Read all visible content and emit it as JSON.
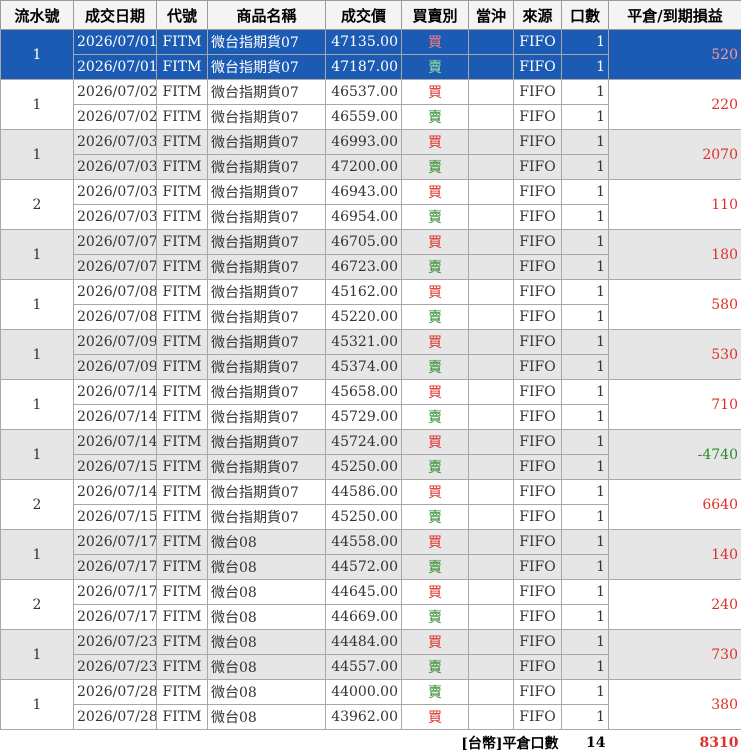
{
  "headers": [
    "流水號",
    "成交日期",
    "代號",
    "商品名稱",
    "成交價",
    "買賣別",
    "當沖",
    "來源",
    "口數",
    "平倉/到期損益"
  ],
  "groups": [
    {
      "seq": "1",
      "pl": "520",
      "pl_sign": "pos",
      "rows": [
        {
          "date": "2026/07/01",
          "code": "FITM",
          "name": "微台指期貨07",
          "price": "47135.00",
          "side": "買",
          "side_type": "buy",
          "daytrade": "",
          "source": "FIFO",
          "qty": "1"
        },
        {
          "date": "2026/07/01",
          "code": "FITM",
          "name": "微台指期貨07",
          "price": "47187.00",
          "side": "賣",
          "side_type": "sell",
          "daytrade": "",
          "source": "FIFO",
          "qty": "1"
        }
      ]
    },
    {
      "seq": "1",
      "pl": "220",
      "pl_sign": "pos",
      "rows": [
        {
          "date": "2026/07/02",
          "code": "FITM",
          "name": "微台指期貨07",
          "price": "46537.00",
          "side": "買",
          "side_type": "buy",
          "daytrade": "",
          "source": "FIFO",
          "qty": "1"
        },
        {
          "date": "2026/07/02",
          "code": "FITM",
          "name": "微台指期貨07",
          "price": "46559.00",
          "side": "賣",
          "side_type": "sell",
          "daytrade": "",
          "source": "FIFO",
          "qty": "1"
        }
      ]
    },
    {
      "seq": "1",
      "pl": "2070",
      "pl_sign": "pos",
      "rows": [
        {
          "date": "2026/07/03",
          "code": "FITM",
          "name": "微台指期貨07",
          "price": "46993.00",
          "side": "買",
          "side_type": "buy",
          "daytrade": "",
          "source": "FIFO",
          "qty": "1"
        },
        {
          "date": "2026/07/03",
          "code": "FITM",
          "name": "微台指期貨07",
          "price": "47200.00",
          "side": "賣",
          "side_type": "sell",
          "daytrade": "",
          "source": "FIFO",
          "qty": "1"
        }
      ]
    },
    {
      "seq": "2",
      "pl": "110",
      "pl_sign": "pos",
      "rows": [
        {
          "date": "2026/07/03",
          "code": "FITM",
          "name": "微台指期貨07",
          "price": "46943.00",
          "side": "買",
          "side_type": "buy",
          "daytrade": "",
          "source": "FIFO",
          "qty": "1"
        },
        {
          "date": "2026/07/03",
          "code": "FITM",
          "name": "微台指期貨07",
          "price": "46954.00",
          "side": "賣",
          "side_type": "sell",
          "daytrade": "",
          "source": "FIFO",
          "qty": "1"
        }
      ]
    },
    {
      "seq": "1",
      "pl": "180",
      "pl_sign": "pos",
      "rows": [
        {
          "date": "2026/07/07",
          "code": "FITM",
          "name": "微台指期貨07",
          "price": "46705.00",
          "side": "買",
          "side_type": "buy",
          "daytrade": "",
          "source": "FIFO",
          "qty": "1"
        },
        {
          "date": "2026/07/07",
          "code": "FITM",
          "name": "微台指期貨07",
          "price": "46723.00",
          "side": "賣",
          "side_type": "sell",
          "daytrade": "",
          "source": "FIFO",
          "qty": "1"
        }
      ]
    },
    {
      "seq": "1",
      "pl": "580",
      "pl_sign": "pos",
      "rows": [
        {
          "date": "2026/07/08",
          "code": "FITM",
          "name": "微台指期貨07",
          "price": "45162.00",
          "side": "買",
          "side_type": "buy",
          "daytrade": "",
          "source": "FIFO",
          "qty": "1"
        },
        {
          "date": "2026/07/08",
          "code": "FITM",
          "name": "微台指期貨07",
          "price": "45220.00",
          "side": "賣",
          "side_type": "sell",
          "daytrade": "",
          "source": "FIFO",
          "qty": "1"
        }
      ]
    },
    {
      "seq": "1",
      "pl": "530",
      "pl_sign": "pos",
      "rows": [
        {
          "date": "2026/07/09",
          "code": "FITM",
          "name": "微台指期貨07",
          "price": "45321.00",
          "side": "買",
          "side_type": "buy",
          "daytrade": "",
          "source": "FIFO",
          "qty": "1"
        },
        {
          "date": "2026/07/09",
          "code": "FITM",
          "name": "微台指期貨07",
          "price": "45374.00",
          "side": "賣",
          "side_type": "sell",
          "daytrade": "",
          "source": "FIFO",
          "qty": "1"
        }
      ]
    },
    {
      "seq": "1",
      "pl": "710",
      "pl_sign": "pos",
      "rows": [
        {
          "date": "2026/07/14",
          "code": "FITM",
          "name": "微台指期貨07",
          "price": "45658.00",
          "side": "買",
          "side_type": "buy",
          "daytrade": "",
          "source": "FIFO",
          "qty": "1"
        },
        {
          "date": "2026/07/14",
          "code": "FITM",
          "name": "微台指期貨07",
          "price": "45729.00",
          "side": "賣",
          "side_type": "sell",
          "daytrade": "",
          "source": "FIFO",
          "qty": "1"
        }
      ]
    },
    {
      "seq": "1",
      "pl": "-4740",
      "pl_sign": "neg",
      "rows": [
        {
          "date": "2026/07/14",
          "code": "FITM",
          "name": "微台指期貨07",
          "price": "45724.00",
          "side": "買",
          "side_type": "buy",
          "daytrade": "",
          "source": "FIFO",
          "qty": "1"
        },
        {
          "date": "2026/07/15",
          "code": "FITM",
          "name": "微台指期貨07",
          "price": "45250.00",
          "side": "賣",
          "side_type": "sell",
          "daytrade": "",
          "source": "FIFO",
          "qty": "1"
        }
      ]
    },
    {
      "seq": "2",
      "pl": "6640",
      "pl_sign": "pos",
      "rows": [
        {
          "date": "2026/07/14",
          "code": "FITM",
          "name": "微台指期貨07",
          "price": "44586.00",
          "side": "買",
          "side_type": "buy",
          "daytrade": "",
          "source": "FIFO",
          "qty": "1"
        },
        {
          "date": "2026/07/15",
          "code": "FITM",
          "name": "微台指期貨07",
          "price": "45250.00",
          "side": "賣",
          "side_type": "sell",
          "daytrade": "",
          "source": "FIFO",
          "qty": "1"
        }
      ]
    },
    {
      "seq": "1",
      "pl": "140",
      "pl_sign": "pos",
      "rows": [
        {
          "date": "2026/07/17",
          "code": "FITM",
          "name": "微台08",
          "price": "44558.00",
          "side": "買",
          "side_type": "buy",
          "daytrade": "",
          "source": "FIFO",
          "qty": "1"
        },
        {
          "date": "2026/07/17",
          "code": "FITM",
          "name": "微台08",
          "price": "44572.00",
          "side": "賣",
          "side_type": "sell",
          "daytrade": "",
          "source": "FIFO",
          "qty": "1"
        }
      ]
    },
    {
      "seq": "2",
      "pl": "240",
      "pl_sign": "pos",
      "rows": [
        {
          "date": "2026/07/17",
          "code": "FITM",
          "name": "微台08",
          "price": "44645.00",
          "side": "買",
          "side_type": "buy",
          "daytrade": "",
          "source": "FIFO",
          "qty": "1"
        },
        {
          "date": "2026/07/17",
          "code": "FITM",
          "name": "微台08",
          "price": "44669.00",
          "side": "賣",
          "side_type": "sell",
          "daytrade": "",
          "source": "FIFO",
          "qty": "1"
        }
      ]
    },
    {
      "seq": "1",
      "pl": "730",
      "pl_sign": "pos",
      "rows": [
        {
          "date": "2026/07/23",
          "code": "FITM",
          "name": "微台08",
          "price": "44484.00",
          "side": "買",
          "side_type": "buy",
          "daytrade": "",
          "source": "FIFO",
          "qty": "1"
        },
        {
          "date": "2026/07/23",
          "code": "FITM",
          "name": "微台08",
          "price": "44557.00",
          "side": "賣",
          "side_type": "sell",
          "daytrade": "",
          "source": "FIFO",
          "qty": "1"
        }
      ]
    },
    {
      "seq": "1",
      "pl": "380",
      "pl_sign": "pos",
      "rows": [
        {
          "date": "2026/07/28",
          "code": "FITM",
          "name": "微台08",
          "price": "44000.00",
          "side": "賣",
          "side_type": "sell",
          "daytrade": "",
          "source": "FIFO",
          "qty": "1"
        },
        {
          "date": "2026/07/28",
          "code": "FITM",
          "name": "微台08",
          "price": "43962.00",
          "side": "買",
          "side_type": "buy",
          "daytrade": "",
          "source": "FIFO",
          "qty": "1"
        }
      ]
    }
  ],
  "total": {
    "label": "[台幣]平倉口數",
    "qty": "14",
    "pl": "8310"
  },
  "colors": {
    "selected_row": "#1c5bb3",
    "alt_row": "#e6e6e6",
    "buy": "#e0302a",
    "sell": "#2a8a2a"
  }
}
